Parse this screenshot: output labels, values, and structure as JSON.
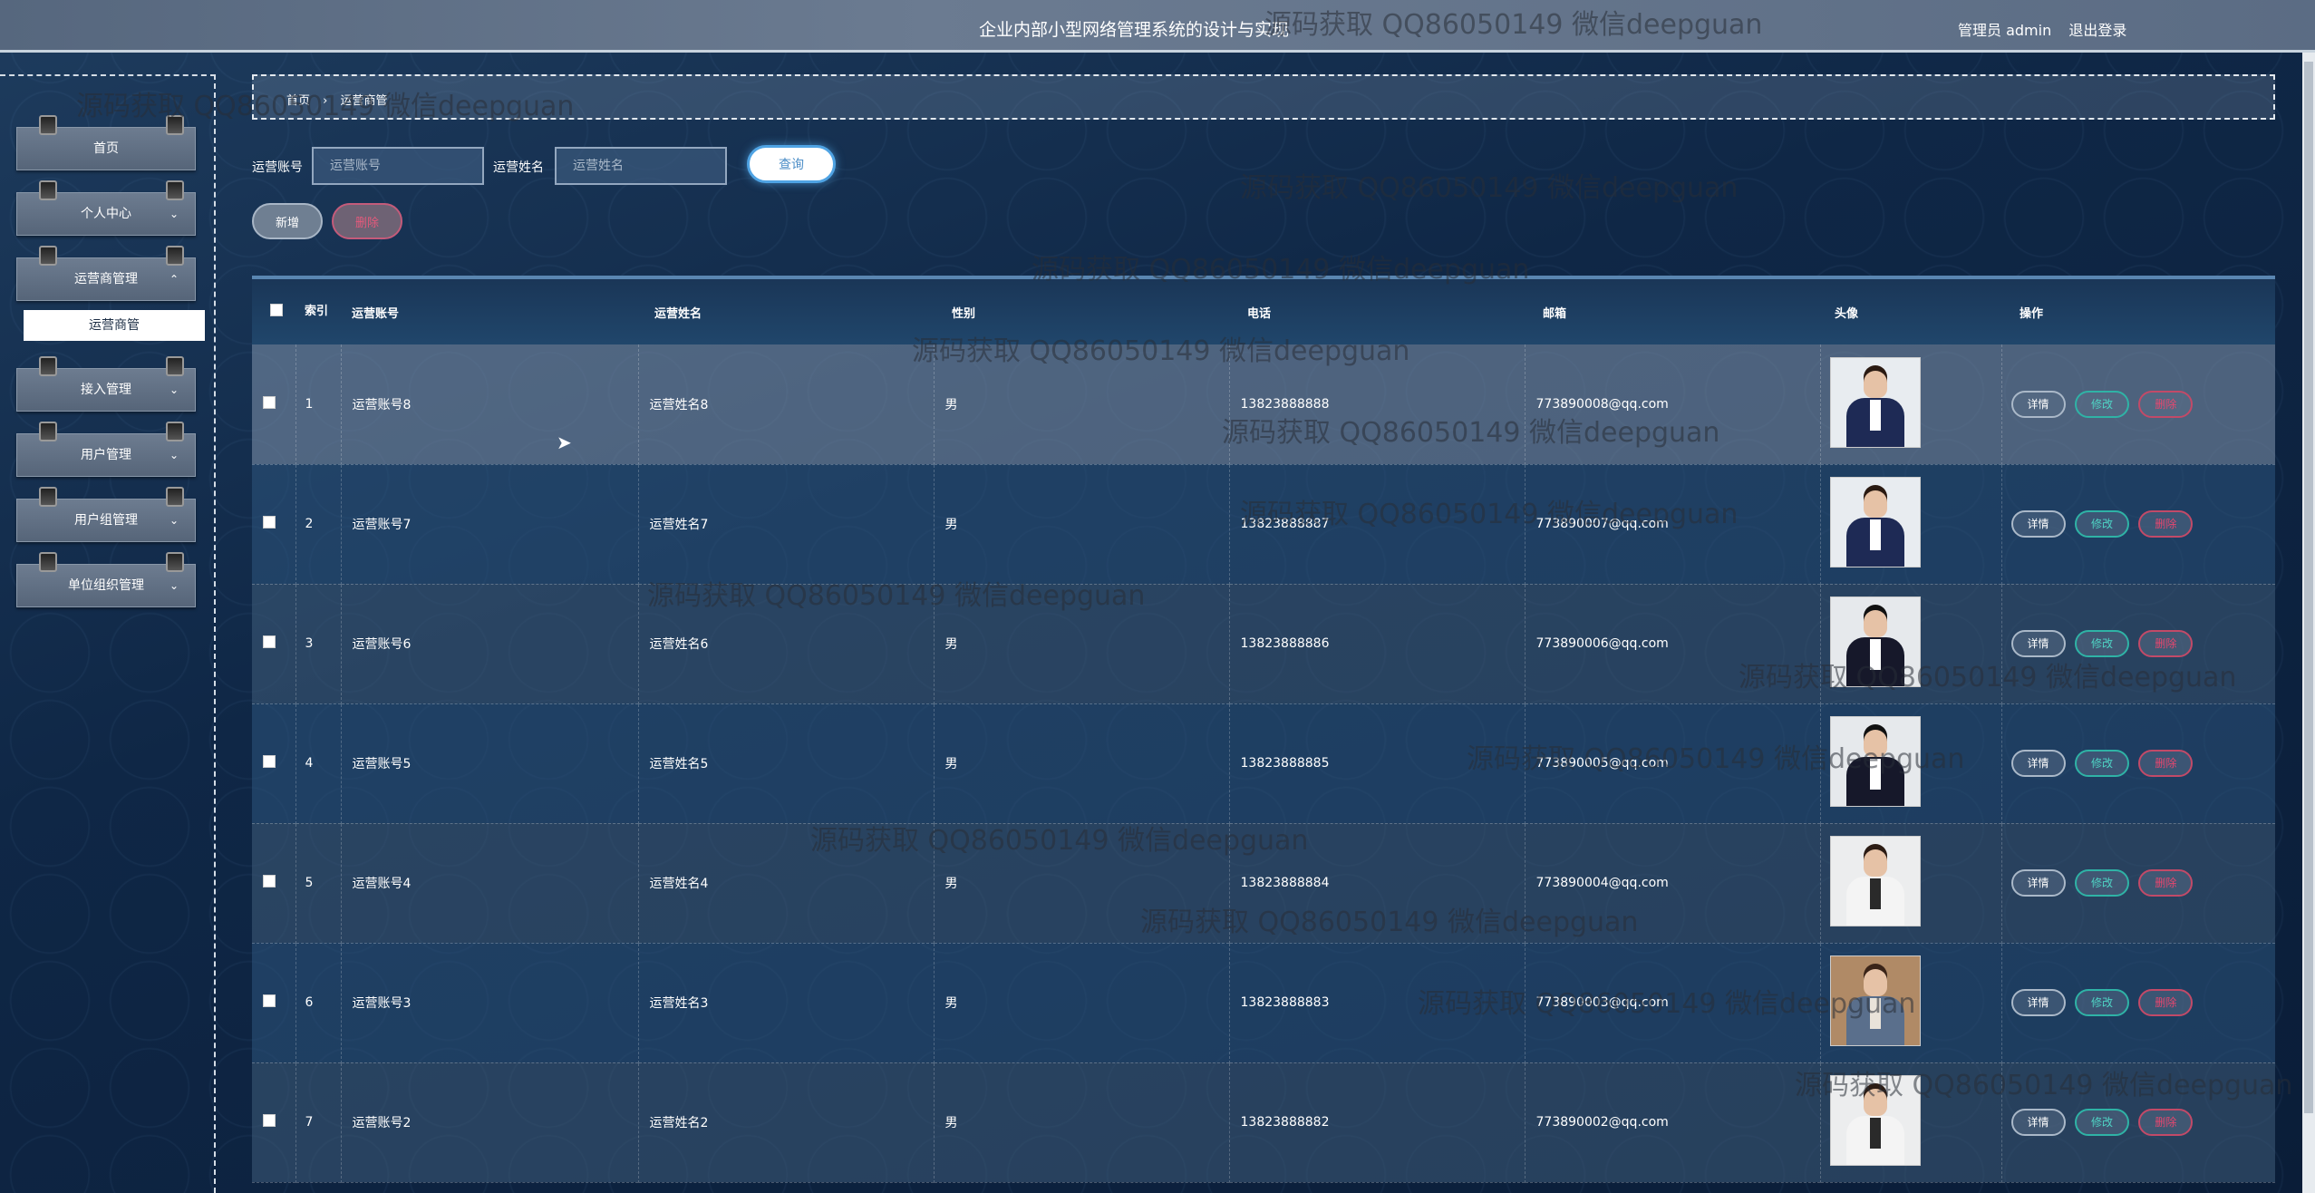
{
  "header": {
    "title": "企业内部小型网络管理系统的设计与实现",
    "user_label": "管理员 admin",
    "logout": "退出登录"
  },
  "sidebar": {
    "items": [
      {
        "label": "首页",
        "chevron": ""
      },
      {
        "label": "个人中心",
        "chevron": "⌄"
      },
      {
        "label": "运营商管理",
        "chevron": "⌃"
      },
      {
        "label": "接入管理",
        "chevron": "⌄"
      },
      {
        "label": "用户管理",
        "chevron": "⌄"
      },
      {
        "label": "用户组管理",
        "chevron": "⌄"
      },
      {
        "label": "单位组织管理",
        "chevron": "⌄"
      }
    ],
    "active_sub": "运营商管"
  },
  "breadcrumb": {
    "home": "首页",
    "sep": "›",
    "current": "运营商管"
  },
  "search": {
    "account_label": "运营账号",
    "account_placeholder": "运营账号",
    "name_label": "运营姓名",
    "name_placeholder": "运营姓名",
    "query_button": "查询"
  },
  "actions": {
    "add": "新增",
    "delete": "删除"
  },
  "table": {
    "columns": [
      "索引",
      "运营账号",
      "运营姓名",
      "性别",
      "电话",
      "邮箱",
      "头像",
      "操作"
    ],
    "row_buttons": {
      "detail": "详情",
      "edit": "修改",
      "delete": "删除"
    },
    "rows": [
      {
        "index": "1",
        "account": "运营账号8",
        "name": "运营姓名8",
        "gender": "男",
        "phone": "13823888888",
        "email": "773890008@qq.com",
        "avatar": "female-suit"
      },
      {
        "index": "2",
        "account": "运营账号7",
        "name": "运营姓名7",
        "gender": "男",
        "phone": "13823888887",
        "email": "773890007@qq.com",
        "avatar": "female-suit"
      },
      {
        "index": "3",
        "account": "运营账号6",
        "name": "运营姓名6",
        "gender": "男",
        "phone": "13823888886",
        "email": "773890006@qq.com",
        "avatar": "male-suit"
      },
      {
        "index": "4",
        "account": "运营账号5",
        "name": "运营姓名5",
        "gender": "男",
        "phone": "13823888885",
        "email": "773890005@qq.com",
        "avatar": "male-suit"
      },
      {
        "index": "5",
        "account": "运营账号4",
        "name": "运营姓名4",
        "gender": "男",
        "phone": "13823888884",
        "email": "773890004@qq.com",
        "avatar": "female-white"
      },
      {
        "index": "6",
        "account": "运营账号3",
        "name": "运营姓名3",
        "gender": "男",
        "phone": "13823888883",
        "email": "773890003@qq.com",
        "avatar": "female-office"
      },
      {
        "index": "7",
        "account": "运营账号2",
        "name": "运营姓名2",
        "gender": "男",
        "phone": "13823888882",
        "email": "773890002@qq.com",
        "avatar": "female-white"
      }
    ]
  },
  "watermark": "源码获取 QQ86050149 微信deepguan",
  "colors": {
    "accent": "#4fa3e3",
    "edit": "#2fb3a6",
    "delete": "#e8476f"
  }
}
